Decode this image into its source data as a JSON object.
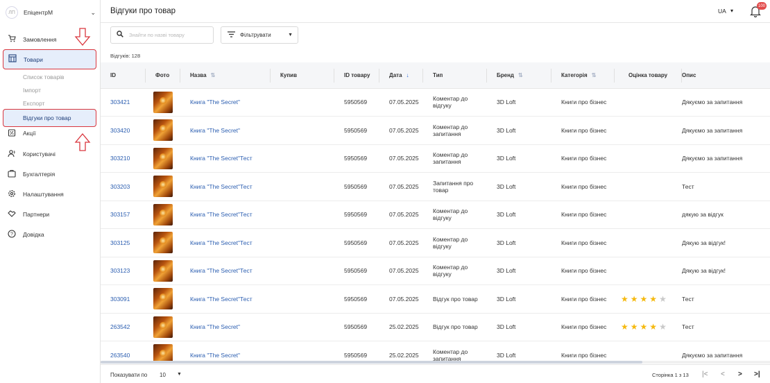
{
  "sidebar": {
    "brand": "ЕпіцентрМ",
    "logo": "ЛП",
    "items": [
      {
        "label": "Замовлення",
        "icon": "cart-icon"
      },
      {
        "label": "Товари",
        "icon": "box-icon",
        "active": true
      },
      {
        "label": "Акції",
        "icon": "discount-icon"
      },
      {
        "label": "Користувачі",
        "icon": "users-icon"
      },
      {
        "label": "Бухгалтерія",
        "icon": "wallet-icon"
      },
      {
        "label": "Налаштування",
        "icon": "gear-icon"
      },
      {
        "label": "Партнери",
        "icon": "handshake-icon"
      },
      {
        "label": "Довідка",
        "icon": "help-icon"
      }
    ],
    "subitems": [
      "Список товарів",
      "Імпорт",
      "Експорт",
      "Відгуки про товар"
    ]
  },
  "header": {
    "title": "Відгуки про товар",
    "lang": "UA",
    "notifications": "100"
  },
  "toolbar": {
    "search_placeholder": "Знайти по назві товару",
    "filter_label": "Фільтрувати",
    "count": "Відгуків: 128"
  },
  "table": {
    "columns": [
      "ID",
      "Фото",
      "Назва",
      "Купив",
      "ID товару",
      "Дата",
      "Тип",
      "Бренд",
      "Категорія",
      "Оцінка товару",
      "Опис"
    ],
    "rows": [
      {
        "id": "303421",
        "name": "Книга \"The Secret\"",
        "bought": "",
        "product_id": "5950569",
        "date": "07.05.2025",
        "type": "Коментар до відгуку",
        "brand": "3D Loft",
        "category": "Книги про бізнес",
        "rating": 0,
        "desc": "Дякуємо за запитання"
      },
      {
        "id": "303420",
        "name": "Книга \"The Secret\"",
        "bought": "",
        "product_id": "5950569",
        "date": "07.05.2025",
        "type": "Коментар до запитання",
        "brand": "3D Loft",
        "category": "Книги про бізнес",
        "rating": 0,
        "desc": "Дякуємо за запитання"
      },
      {
        "id": "303210",
        "name": "Книга \"The Secret\"Тест",
        "bought": "",
        "product_id": "5950569",
        "date": "07.05.2025",
        "type": "Коментар до запитання",
        "brand": "3D Loft",
        "category": "Книги про бізнес",
        "rating": 0,
        "desc": "Дякуємо за запитання"
      },
      {
        "id": "303203",
        "name": "Книга \"The Secret\"Тест",
        "bought": "",
        "product_id": "5950569",
        "date": "07.05.2025",
        "type": "Запитання про товар",
        "brand": "3D Loft",
        "category": "Книги про бізнес",
        "rating": 0,
        "desc": "Тест"
      },
      {
        "id": "303157",
        "name": "Книга \"The Secret\"Тест",
        "bought": "",
        "product_id": "5950569",
        "date": "07.05.2025",
        "type": "Коментар до відгуку",
        "brand": "3D Loft",
        "category": "Книги про бізнес",
        "rating": 0,
        "desc": "дякую за відгук"
      },
      {
        "id": "303125",
        "name": "Книга \"The Secret\"Тест",
        "bought": "",
        "product_id": "5950569",
        "date": "07.05.2025",
        "type": "Коментар до відгуку",
        "brand": "3D Loft",
        "category": "Книги про бізнес",
        "rating": 0,
        "desc": "Дякую за відгук!"
      },
      {
        "id": "303123",
        "name": "Книга \"The Secret\"Тест",
        "bought": "",
        "product_id": "5950569",
        "date": "07.05.2025",
        "type": "Коментар до відгуку",
        "brand": "3D Loft",
        "category": "Книги про бізнес",
        "rating": 0,
        "desc": "Дякую за відгук!"
      },
      {
        "id": "303091",
        "name": "Книга \"The Secret\"Тест",
        "bought": "",
        "product_id": "5950569",
        "date": "07.05.2025",
        "type": "Відгук про товар",
        "brand": "3D Loft",
        "category": "Книги про бізнес",
        "rating": 4,
        "desc": "Тест"
      },
      {
        "id": "263542",
        "name": "Книга \"The Secret\"",
        "bought": "",
        "product_id": "5950569",
        "date": "25.02.2025",
        "type": "Відгук про товар",
        "brand": "3D Loft",
        "category": "Книги про бізнес",
        "rating": 4,
        "desc": "Тест"
      },
      {
        "id": "263540",
        "name": "Книга \"The Secret\"",
        "bought": "",
        "product_id": "5950569",
        "date": "25.02.2025",
        "type": "Коментар до запитання",
        "brand": "3D Loft",
        "category": "Книги про бізнес",
        "rating": 0,
        "desc": "Дякуємо за запитання"
      }
    ]
  },
  "footer": {
    "per_page_label": "Показувати по",
    "per_page_value": "10",
    "pages": "Сторінка 1 з 13"
  },
  "colors": {
    "accent": "#2a5db0",
    "highlight_border": "#d9363e",
    "star": "#f5b90f"
  }
}
